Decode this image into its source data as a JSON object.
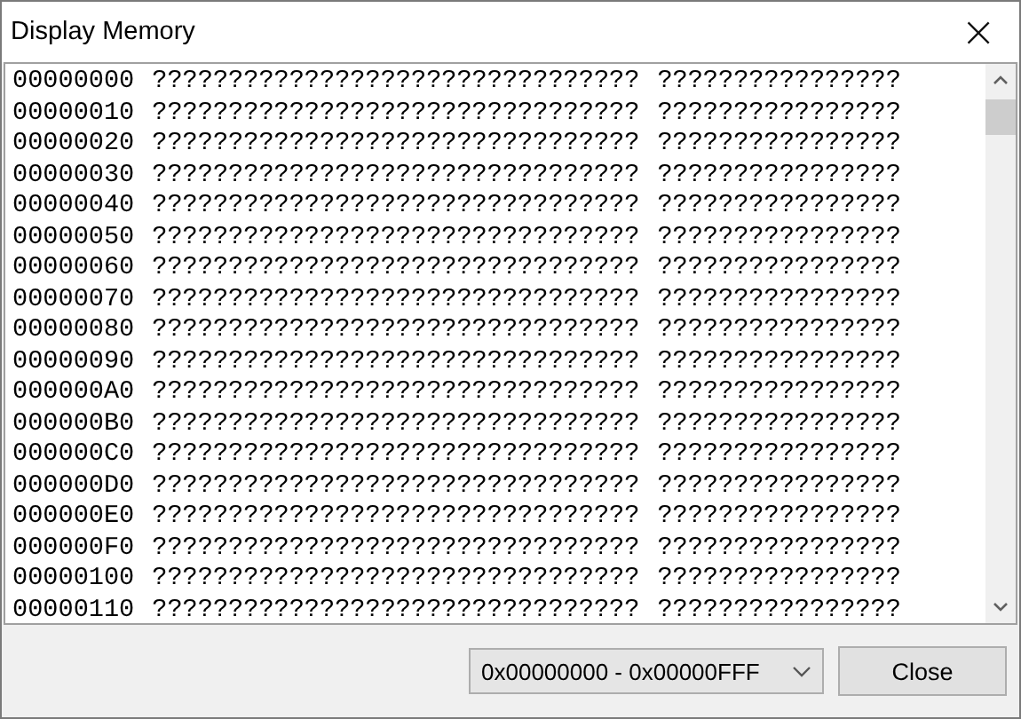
{
  "window": {
    "title": "Display Memory",
    "close": "×"
  },
  "memory": {
    "rows": [
      {
        "address": "00000000",
        "hex": "????????????????????????????????",
        "ascii": "????????????????"
      },
      {
        "address": "00000010",
        "hex": "????????????????????????????????",
        "ascii": "????????????????"
      },
      {
        "address": "00000020",
        "hex": "????????????????????????????????",
        "ascii": "????????????????"
      },
      {
        "address": "00000030",
        "hex": "????????????????????????????????",
        "ascii": "????????????????"
      },
      {
        "address": "00000040",
        "hex": "????????????????????????????????",
        "ascii": "????????????????"
      },
      {
        "address": "00000050",
        "hex": "????????????????????????????????",
        "ascii": "????????????????"
      },
      {
        "address": "00000060",
        "hex": "????????????????????????????????",
        "ascii": "????????????????"
      },
      {
        "address": "00000070",
        "hex": "????????????????????????????????",
        "ascii": "????????????????"
      },
      {
        "address": "00000080",
        "hex": "????????????????????????????????",
        "ascii": "????????????????"
      },
      {
        "address": "00000090",
        "hex": "????????????????????????????????",
        "ascii": "????????????????"
      },
      {
        "address": "000000A0",
        "hex": "????????????????????????????????",
        "ascii": "????????????????"
      },
      {
        "address": "000000B0",
        "hex": "????????????????????????????????",
        "ascii": "????????????????"
      },
      {
        "address": "000000C0",
        "hex": "????????????????????????????????",
        "ascii": "????????????????"
      },
      {
        "address": "000000D0",
        "hex": "????????????????????????????????",
        "ascii": "????????????????"
      },
      {
        "address": "000000E0",
        "hex": "????????????????????????????????",
        "ascii": "????????????????"
      },
      {
        "address": "000000F0",
        "hex": "????????????????????????????????",
        "ascii": "????????????????"
      },
      {
        "address": "00000100",
        "hex": "????????????????????????????????",
        "ascii": "????????????????"
      },
      {
        "address": "00000110",
        "hex": "????????????????????????????????",
        "ascii": "????????????????"
      }
    ]
  },
  "range_select": {
    "value": "0x00000000 - 0x00000FFF"
  },
  "buttons": [
    "Close"
  ]
}
